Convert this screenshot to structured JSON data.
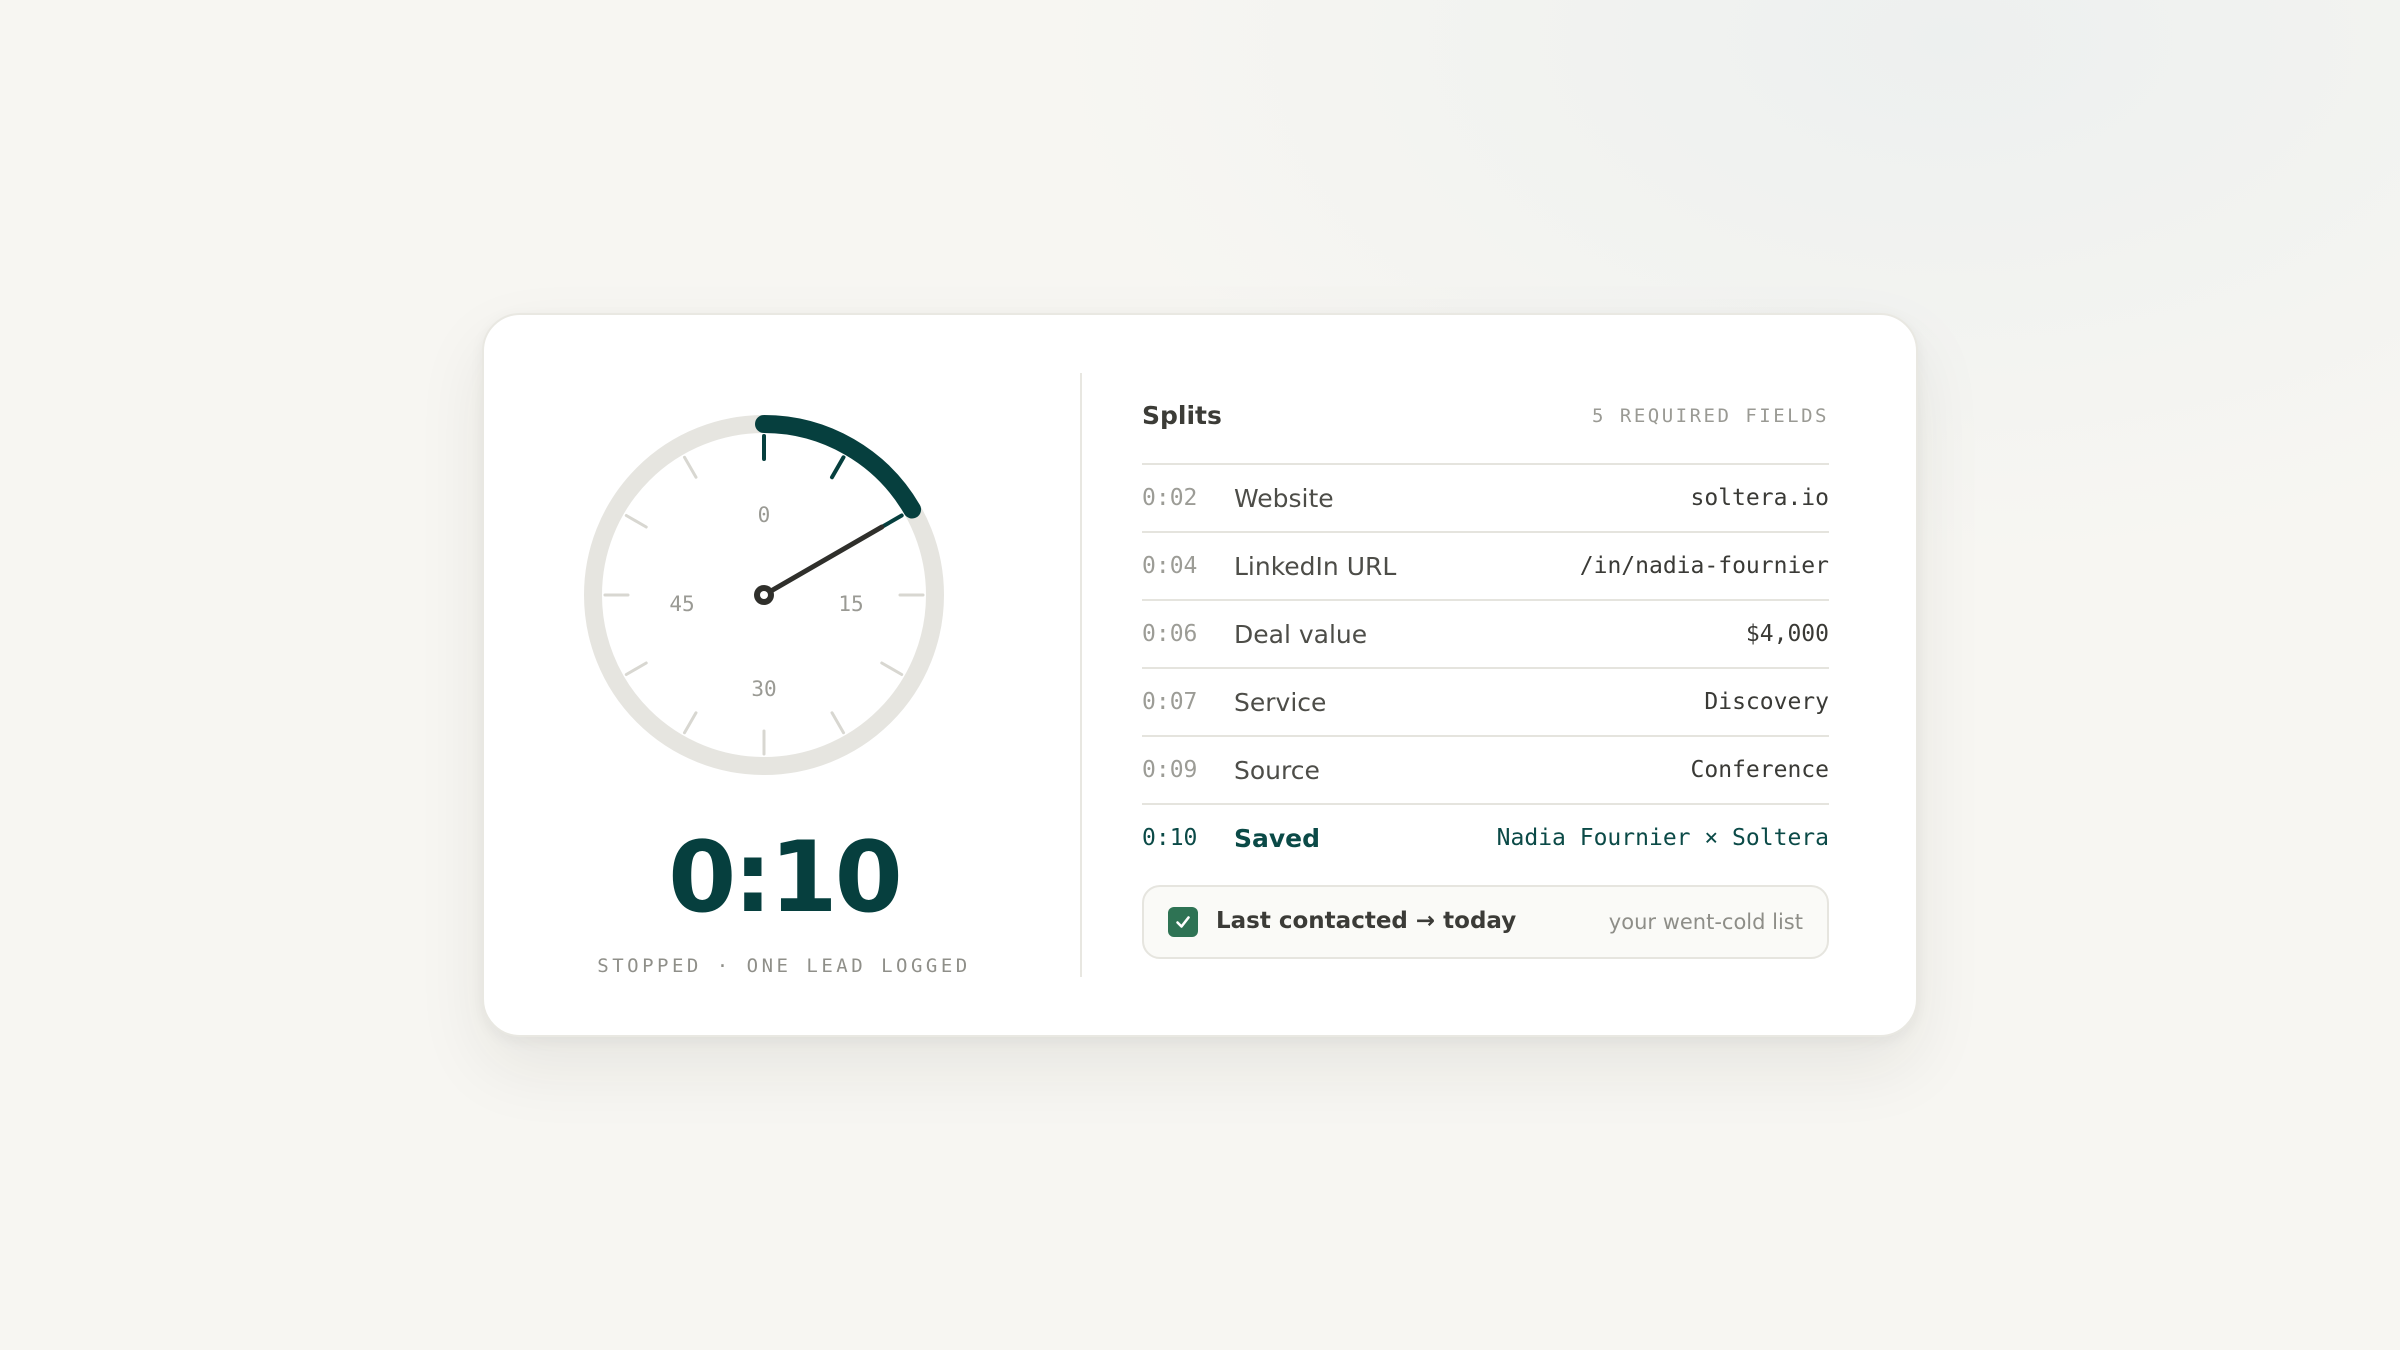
{
  "stopwatch": {
    "elapsed": "0:10",
    "elapsed_seconds": 10,
    "dial_full_scale_seconds": 60,
    "status": "STOPPED · ONE LEAD LOGGED",
    "dial_labels": {
      "top": "0",
      "right": "15",
      "bottom": "30",
      "left": "45"
    }
  },
  "splits": {
    "title": "Splits",
    "count_label": "5 REQUIRED FIELDS",
    "rows": [
      {
        "time": "0:02",
        "field": "Website",
        "value": "soltera.io"
      },
      {
        "time": "0:04",
        "field": "LinkedIn URL",
        "value": "/in/nadia-fournier"
      },
      {
        "time": "0:06",
        "field": "Deal value",
        "value": "$4,000"
      },
      {
        "time": "0:07",
        "field": "Service",
        "value": "Discovery"
      },
      {
        "time": "0:09",
        "field": "Source",
        "value": "Conference"
      },
      {
        "time": "0:10",
        "field": "Saved",
        "value": "Nadia Fournier × Soltera"
      }
    ]
  },
  "notice": {
    "label": "Last contacted → today",
    "hint": "your went-cold list",
    "checked": true
  },
  "colors": {
    "accent": "#063f3e",
    "check": "#2e7354",
    "track": "#e6e5e0",
    "hand": "#2f2f2b"
  }
}
